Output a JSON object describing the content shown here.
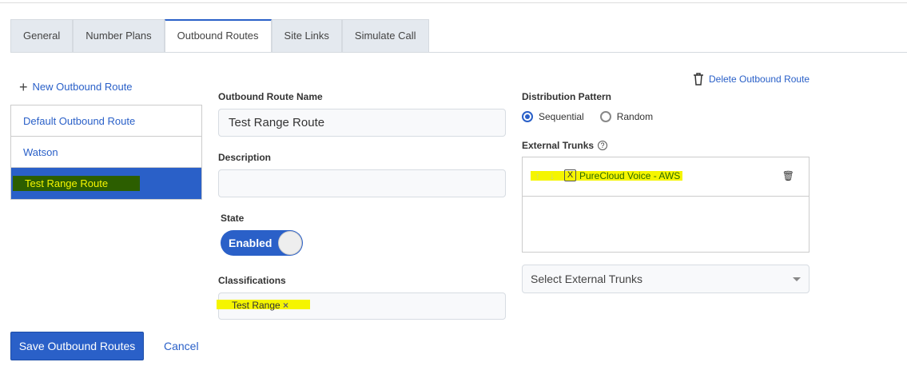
{
  "tabs": [
    {
      "label": "General"
    },
    {
      "label": "Number Plans"
    },
    {
      "label": "Outbound Routes"
    },
    {
      "label": "Site Links"
    },
    {
      "label": "Simulate Call"
    }
  ],
  "sidebar": {
    "new_label": "New Outbound Route",
    "items": [
      {
        "label": "Default Outbound Route"
      },
      {
        "label": "Watson"
      },
      {
        "label": "Test Range Route"
      }
    ]
  },
  "form": {
    "name_label": "Outbound Route Name",
    "name_value": "Test Range Route",
    "description_label": "Description",
    "description_value": "",
    "state_label": "State",
    "state_value": "Enabled",
    "classifications_label": "Classifications",
    "classification_chip": "Test Range",
    "chip_remove": "×"
  },
  "right": {
    "delete_label": "Delete Outbound Route",
    "distribution_label": "Distribution Pattern",
    "options": [
      {
        "label": "Sequential",
        "selected": true
      },
      {
        "label": "Random",
        "selected": false
      }
    ],
    "trunks_label": "External Trunks",
    "help": "?",
    "trunks": [
      {
        "name": "PureCloud Voice - AWS"
      }
    ],
    "select_placeholder": "Select External Trunks"
  },
  "footer": {
    "save_label": "Save Outbound Routes",
    "cancel_label": "Cancel"
  },
  "colors": {
    "accent": "#2a60c8",
    "highlight": "#f5f500"
  }
}
